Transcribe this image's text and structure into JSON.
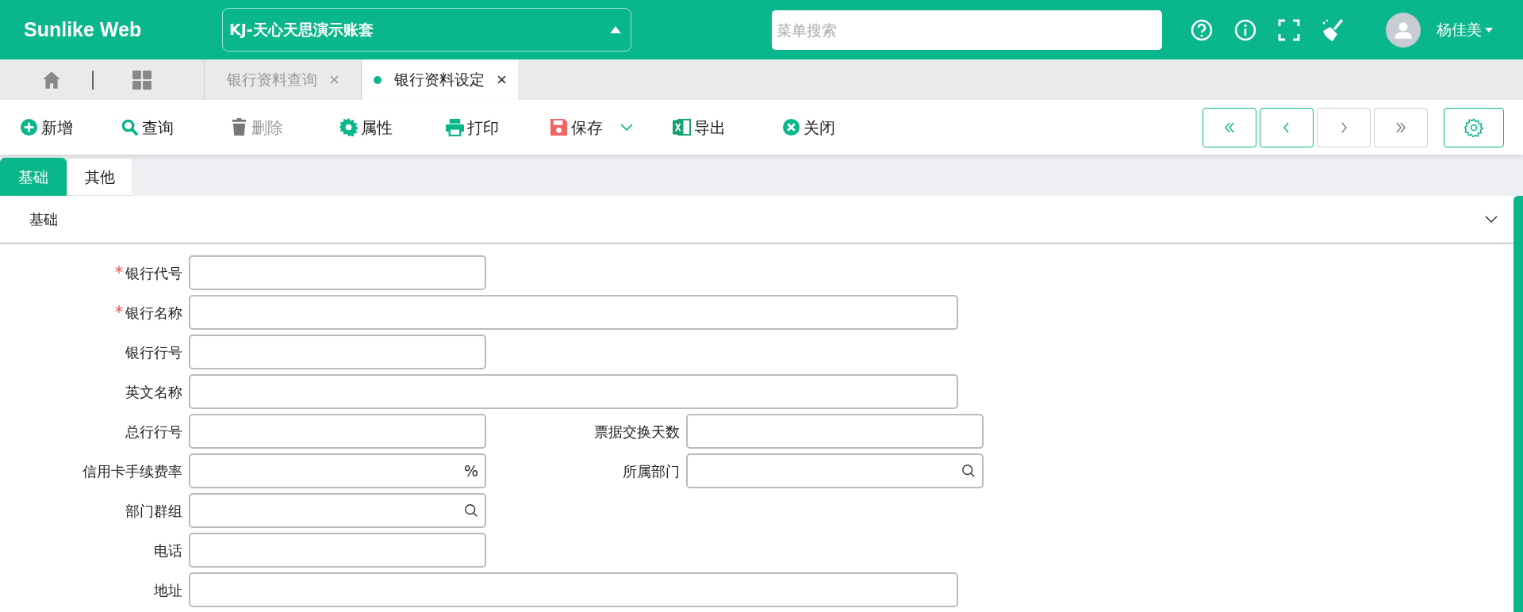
{
  "header": {
    "logo": "Sunlike Web",
    "account": "KJ-天心天思演示账套",
    "search": {
      "placeholder": "菜单搜索"
    },
    "icons": [
      {
        "kind": "help"
      },
      {
        "kind": "info"
      },
      {
        "kind": "fullscreen"
      },
      {
        "kind": "broom"
      }
    ],
    "user": "杨佳美"
  },
  "page_tabs": [
    {
      "label": "银行资料查询",
      "selected": false
    },
    {
      "label": "银行资料设定",
      "selected": true
    }
  ],
  "toolbar": [
    {
      "kind": "add",
      "label": "新增",
      "disabled": false,
      "dropdown": false
    },
    {
      "kind": "search",
      "label": "查询",
      "disabled": false,
      "dropdown": false
    },
    {
      "kind": "delete",
      "label": "删除",
      "disabled": true,
      "dropdown": false
    },
    {
      "kind": "gear",
      "label": "属性",
      "disabled": false,
      "dropdown": false
    },
    {
      "kind": "print",
      "label": "打印",
      "disabled": false,
      "dropdown": false
    },
    {
      "kind": "save",
      "label": "保存",
      "disabled": false,
      "dropdown": true
    },
    {
      "kind": "excel",
      "label": "导出",
      "disabled": false,
      "dropdown": false
    },
    {
      "kind": "close",
      "label": "关闭",
      "disabled": false,
      "dropdown": false
    }
  ],
  "record_nav": [
    {
      "kind": "first",
      "disabled": false
    },
    {
      "kind": "prev",
      "disabled": false
    },
    {
      "kind": "next",
      "disabled": true
    },
    {
      "kind": "last",
      "disabled": true
    }
  ],
  "form_tabs": [
    {
      "label": "基础",
      "selected": true
    },
    {
      "label": "其他",
      "selected": false
    }
  ],
  "section": {
    "title": "基础",
    "expanded": true,
    "rows": [
      {
        "fields": [
          {
            "label": "银行代号",
            "required": true,
            "kind": "text",
            "wide": false
          }
        ]
      },
      {
        "fields": [
          {
            "label": "银行名称",
            "required": true,
            "kind": "text",
            "wide": true
          }
        ]
      },
      {
        "fields": [
          {
            "label": "银行行号",
            "required": false,
            "kind": "text",
            "wide": false
          }
        ]
      },
      {
        "fields": [
          {
            "label": "英文名称",
            "required": false,
            "kind": "text",
            "wide": true
          }
        ]
      },
      {
        "fields": [
          {
            "label": "总行行号",
            "required": false,
            "kind": "text",
            "wide": false
          },
          {
            "label": "票据交换天数",
            "required": false,
            "kind": "text",
            "wide": false
          }
        ]
      },
      {
        "fields": [
          {
            "label": "信用卡手续费率",
            "required": false,
            "kind": "percent",
            "wide": false,
            "suffix": "%"
          },
          {
            "label": "所属部门",
            "required": false,
            "kind": "lookup",
            "wide": false
          }
        ]
      },
      {
        "fields": [
          {
            "label": "部门群组",
            "required": false,
            "kind": "lookup",
            "wide": false
          }
        ]
      },
      {
        "fields": [
          {
            "label": "电话",
            "required": false,
            "kind": "text",
            "wide": false
          }
        ]
      },
      {
        "fields": [
          {
            "label": "地址",
            "required": false,
            "kind": "text",
            "wide": true
          }
        ]
      }
    ]
  }
}
